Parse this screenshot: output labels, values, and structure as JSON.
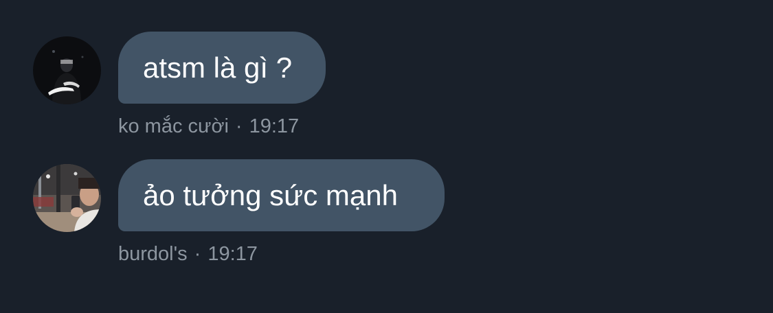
{
  "messages": [
    {
      "text": "atsm là gì ?",
      "author": "ko mắc cười",
      "time": "19:17",
      "avatar_icon": "user-avatar-dark-photo"
    },
    {
      "text": "ảo tưởng sức mạnh",
      "author": "burdol's",
      "time": "19:17",
      "avatar_icon": "user-avatar-selfie-photo"
    }
  ],
  "meta_separator": "·",
  "colors": {
    "background": "#19202a",
    "bubble": "#425466",
    "bubble_text": "#ffffff",
    "meta_text": "#8d96a0"
  }
}
